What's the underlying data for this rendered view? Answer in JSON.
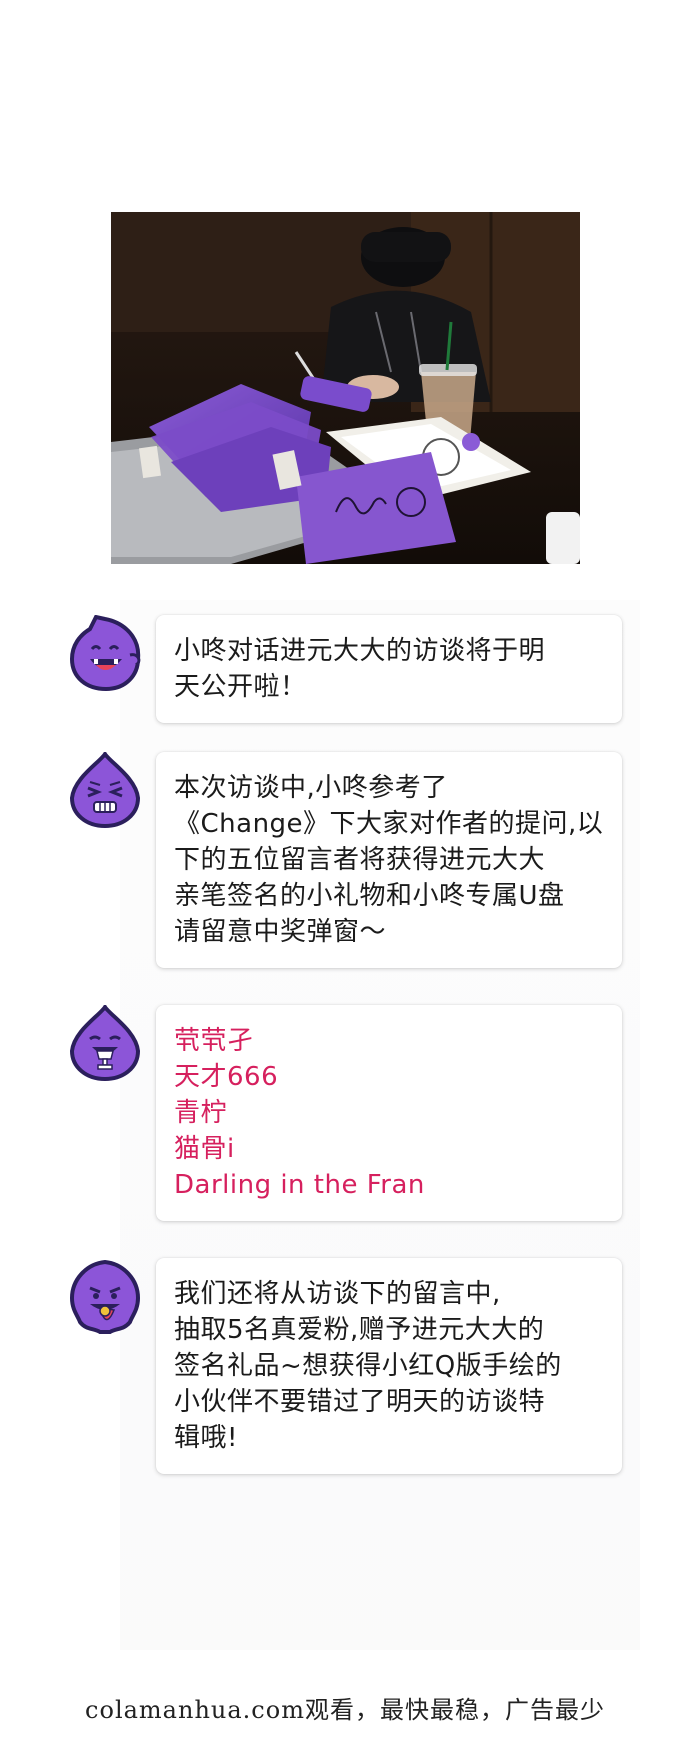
{
  "photo": {
    "alt_subject": "purple pouches, book, coffee cup"
  },
  "messages": [
    {
      "avatar_icon": "purple-ghost-smile-icon",
      "lines": [
        "小咚对话进元大大的访谈将于明",
        "天公开啦！"
      ]
    },
    {
      "avatar_icon": "purple-ghost-squint-icon",
      "lines": [
        "本次访谈中,小咚参考了",
        "《Change》下大家对作者的提问,以",
        "下的五位留言者将获得进元大大",
        "亲笔签名的小礼物和小咚专属U盘",
        "请留意中奖弹窗～"
      ]
    },
    {
      "avatar_icon": "purple-ghost-trophy-icon",
      "lines": [
        "茕茕孑",
        "天才666",
        "青柠",
        "猫骨i",
        "Darling in the Fran"
      ]
    },
    {
      "avatar_icon": "purple-ghost-tongue-icon",
      "lines": [
        "我们还将从访谈下的留言中,",
        "抽取5名真爱粉,赠予进元大大的",
        "签名礼品~想获得小红Q版手绘的",
        "小伙伴不要错过了明天的访谈特",
        "辑哦!"
      ]
    }
  ],
  "colors": {
    "avatar_purple": "#8c55d8",
    "avatar_dark": "#2b1f5c",
    "names_text": "#d6205e"
  },
  "footer": {
    "text": "colamanhua.com观看，最快最稳，广告最少"
  }
}
